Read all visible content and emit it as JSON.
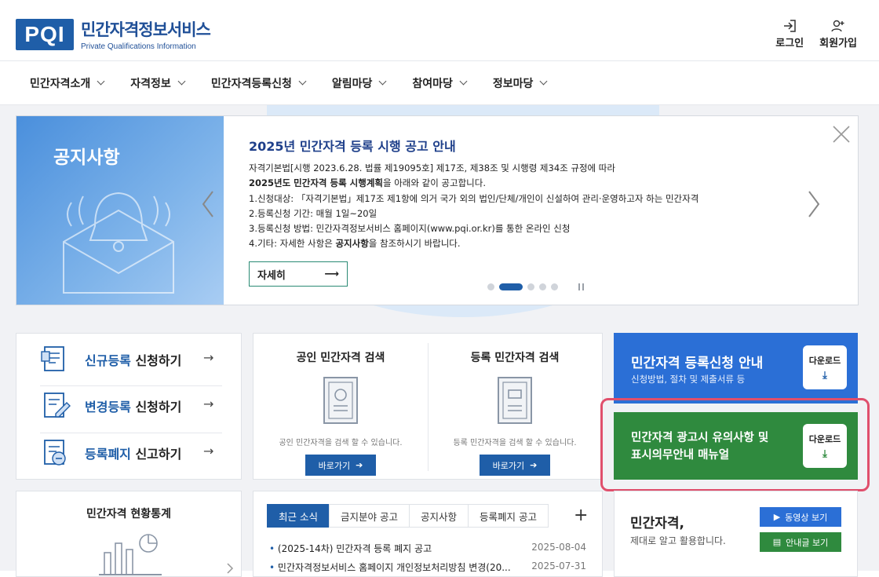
{
  "header": {
    "logo_mark": "PQI",
    "logo_ko": "민간자격정보서비스",
    "logo_en": "Private Qualifications Information",
    "login": "로그인",
    "signup": "회원가입"
  },
  "gnb": [
    "민간자격소개",
    "자격정보",
    "민간자격등록신청",
    "알림마당",
    "참여마당",
    "정보마당"
  ],
  "banner": {
    "label": "공지사항",
    "title": "2025년 민간자격 등록 시행 공고 안내",
    "line1": "자격기본법[시행 2023.6.28. 법률 제19095호] 제17조, 제38조 및 시행령 제34조 규정에 따라",
    "line2_bold": "2025년도 민간자격 등록 시행계획",
    "line2_rest": "을 아래와 같이 공고합니다.",
    "line3": "1.신청대상: 「자격기본법」제17조 제1항에 의거 국가 외의 법인/단체/개인이 신설하여 관리·운영하고자 하는 민간자격",
    "line4": "2.등록신청 기간: 매월 1일~20일",
    "line5": "3.등록신청 방법: 민간자격정보서비스 홈페이지(www.pqi.or.kr)를 통한 온라인 신청",
    "line6_pre": "4.기타: 자세한 사항은 ",
    "line6_bold": "공지사항",
    "line6_post": "을 참조하시기 바랍니다.",
    "more": "자세히",
    "active_slide": 2,
    "slide_count": 5
  },
  "registration": [
    {
      "hl": "신규등록",
      "rest": " 신청하기"
    },
    {
      "hl": "변경등록",
      "rest": " 신청하기"
    },
    {
      "hl": "등록폐지",
      "rest": " 신고하기"
    }
  ],
  "search": [
    {
      "title": "공인 민간자격 검색",
      "desc": "공인 민간자격을 검색 할 수 있습니다.",
      "btn": "바로가기"
    },
    {
      "title": "등록 민간자격 검색",
      "desc": "등록 민간자격을 검색 할 수 있습니다.",
      "btn": "바로가기"
    }
  ],
  "panels": {
    "blue_title": "민간자격 등록신청 안내",
    "blue_sub": "신청방법, 절차 및 제출서류 등",
    "green_title1": "민간자격 광고시 유의사항 및",
    "green_title2": "표시의무안내 매뉴얼",
    "download": "다운로드"
  },
  "stats": {
    "title": "민간자격 현황통계"
  },
  "news": {
    "tabs": [
      "최근 소식",
      "금지분야 공고",
      "공지사항",
      "등록폐지 공고"
    ],
    "items": [
      {
        "title": "(2025-14차) 민간자격 등록 폐지 공고",
        "date": "2025-08-04"
      },
      {
        "title": "민간자격정보서비스 홈페이지 개인정보처리방침 변경(20...",
        "date": "2025-07-31"
      }
    ]
  },
  "utility": {
    "title": "민간자격,",
    "sub": "제대로 알고 활용합니다.",
    "video_btn": "동영상 보기",
    "guide_btn": "안내글 보기"
  },
  "colors": {
    "brand": "#1f5ea8",
    "blue_panel": "#2b6fd6",
    "green_panel": "#2f8a3e",
    "highlight_frame": "#e04f6c"
  }
}
